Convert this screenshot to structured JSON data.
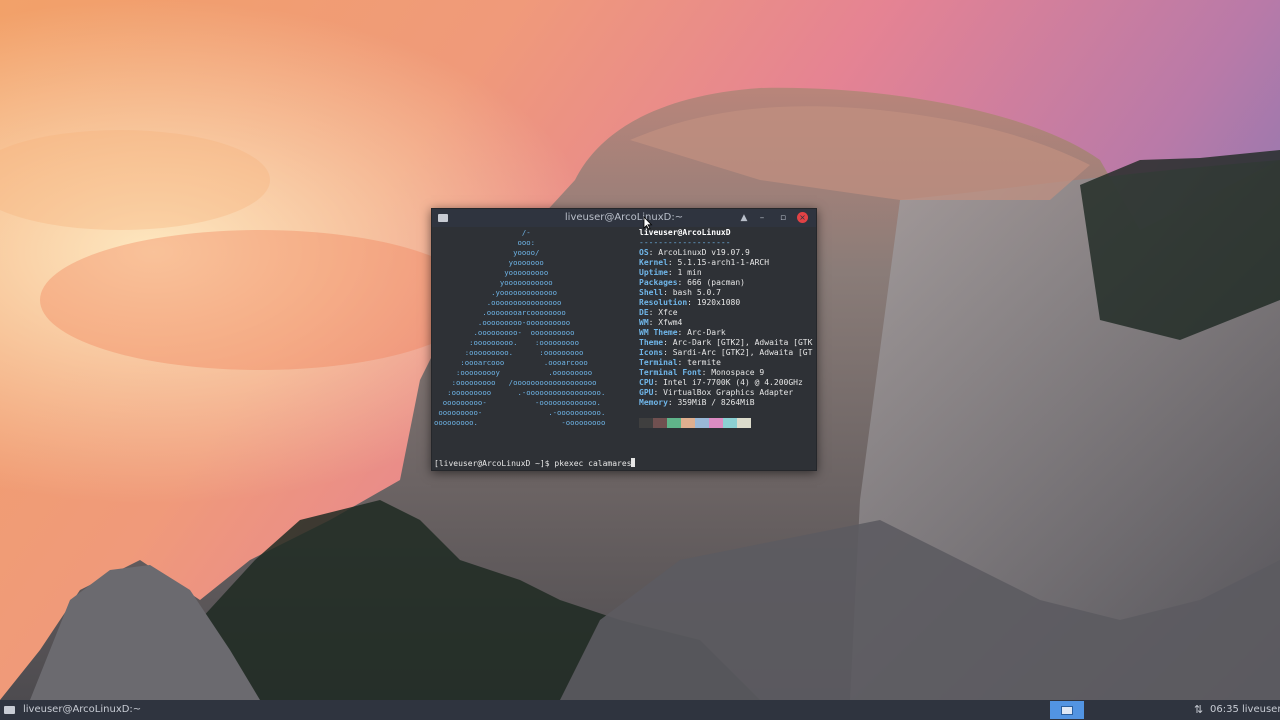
{
  "window": {
    "title": "liveuser@ArcoLinuxD:~",
    "buttons": {
      "up": "▲",
      "minimize": "–",
      "maximize": "▫",
      "close": "×"
    }
  },
  "neofetch": {
    "ascii_art": "                    /-\n                   ooo:\n                  yoooo/\n                 yooooooo\n                yooooooooo\n               yooooooooooo\n             .yooooooooooooo\n            .oooooooooooooooo\n           .oooooooarcoooooooo\n          .ooooooooo-oooooooooo\n         .ooooooooo-  oooooooooo\n        :ooooooooo.    :ooooooooo\n       :ooooooooo.      :ooooooooo\n      :oooarcooo         .oooarcooo\n     :ooooooooy           .ooooooooo\n    :ooooooooo   /ooooooooooooooooooo\n   :ooooooooo      .-ooooooooooooooooo.\n  ooooooooo-           -ooooooooooooo.\n ooooooooo-               .-oooooooooo.\nooooooooo.                   -ooooooooo",
    "header": "liveuser@ArcoLinuxD",
    "separator": "-------------------",
    "lines": [
      {
        "key": "OS",
        "value": "ArcoLinuxD v19.07.9"
      },
      {
        "key": "Kernel",
        "value": "5.1.15-arch1-1-ARCH"
      },
      {
        "key": "Uptime",
        "value": "1 min"
      },
      {
        "key": "Packages",
        "value": "666 (pacman)"
      },
      {
        "key": "Shell",
        "value": "bash 5.0.7"
      },
      {
        "key": "Resolution",
        "value": "1920x1080"
      },
      {
        "key": "DE",
        "value": "Xfce"
      },
      {
        "key": "WM",
        "value": "Xfwm4"
      },
      {
        "key": "WM Theme",
        "value": "Arc-Dark"
      },
      {
        "key": "Theme",
        "value": "Arc-Dark [GTK2], Adwaita [GTK"
      },
      {
        "key": "Icons",
        "value": "Sardi-Arc [GTK2], Adwaita [GT"
      },
      {
        "key": "Terminal",
        "value": "termite"
      },
      {
        "key": "Terminal Font",
        "value": "Monospace 9"
      },
      {
        "key": "CPU",
        "value": "Intel i7-7700K (4) @ 4.200GHz"
      },
      {
        "key": "GPU",
        "value": "VirtualBox Graphics Adapter"
      },
      {
        "key": "Memory",
        "value": "359MiB / 8264MiB"
      }
    ],
    "palette": [
      "#3f3f3f",
      "#705050",
      "#60b48a",
      "#dfaf8f",
      "#9ab8d7",
      "#dc8cc3",
      "#8cd0d3",
      "#dcdccc"
    ]
  },
  "prompt": {
    "text": "[liveuser@ArcoLinuxD ~]$ ",
    "command": "pkexec calamares"
  },
  "taskbar": {
    "window_item": "liveuser@ArcoLinuxD:~",
    "clock": "06:35",
    "user": "liveuser",
    "network_icon": "network-transfer-icon"
  }
}
